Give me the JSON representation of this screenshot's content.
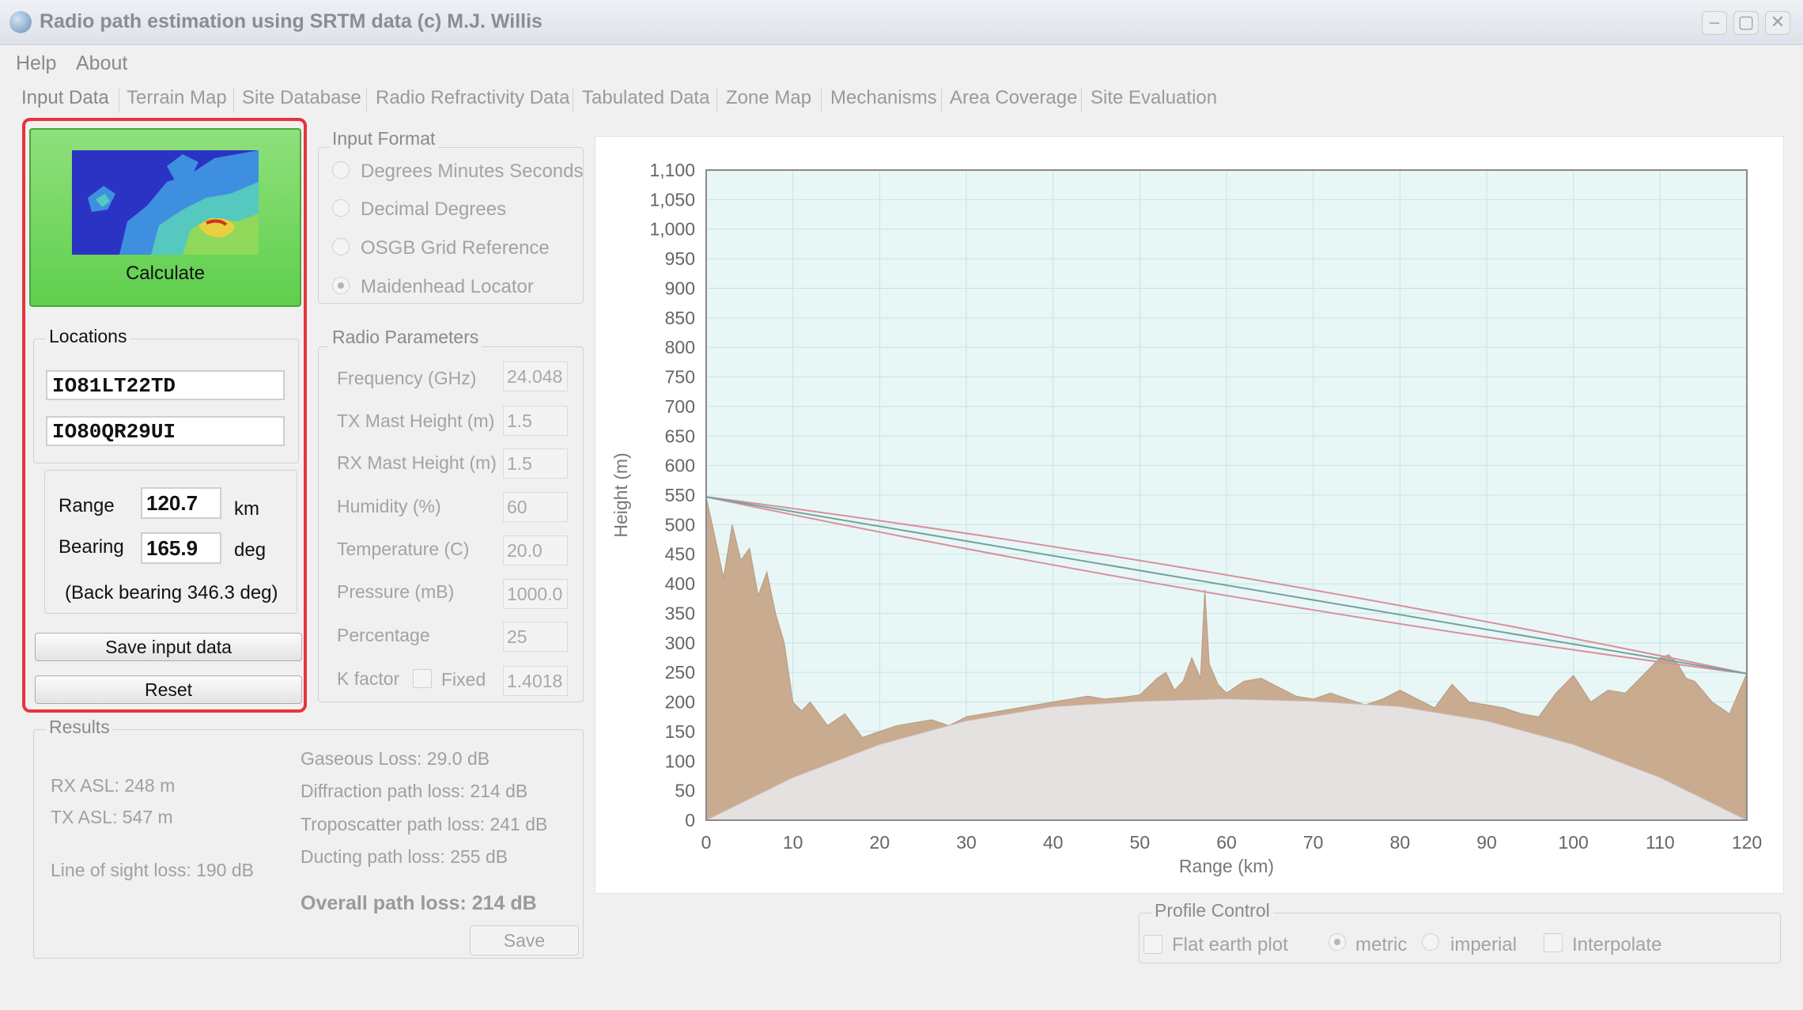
{
  "window": {
    "title": "Radio path estimation using SRTM data (c) M.J. Willis"
  },
  "menu": [
    "Help",
    "About"
  ],
  "tabs": [
    "Input Data",
    "Terrain Map",
    "Site Database",
    "Radio Refractivity Data",
    "Tabulated Data",
    "Zone Map",
    "Mechanisms",
    "Area Coverage",
    "Site Evaluation"
  ],
  "calculate": {
    "label": "Calculate"
  },
  "locations": {
    "title": "Locations",
    "tx": "IO81LT22TD",
    "rx": "IO80QR29UI",
    "range_label": "Range",
    "range": "120.7",
    "range_unit": "km",
    "bearing_label": "Bearing",
    "bearing": "165.9",
    "bearing_unit": "deg",
    "back_bearing": "(Back bearing 346.3 deg)"
  },
  "buttons": {
    "save_input": "Save input data",
    "reset": "Reset",
    "save": "Save"
  },
  "input_format": {
    "title": "Input Format",
    "options": [
      "Degrees Minutes Seconds",
      "Decimal Degrees",
      "OSGB Grid Reference",
      "Maidenhead Locator"
    ],
    "selected": "Maidenhead Locator"
  },
  "radio_params": {
    "title": "Radio Parameters",
    "frequency_label": "Frequency (GHz)",
    "frequency": "24.048",
    "tx_mast_label": "TX Mast Height (m)",
    "tx_mast": "1.5",
    "rx_mast_label": "RX Mast Height (m)",
    "rx_mast": "1.5",
    "humidity_label": "Humidity (%)",
    "humidity": "60",
    "temperature_label": "Temperature (C)",
    "temperature": "20.0",
    "pressure_label": "Pressure (mB)",
    "pressure": "1000.0",
    "percentage_label": "Percentage",
    "percentage": "25",
    "kfactor_label": "K factor",
    "fixed_label": "Fixed",
    "kfactor": "1.4018"
  },
  "results": {
    "title": "Results",
    "rx_asl": "RX ASL: 248 m",
    "tx_asl": "TX ASL: 547 m",
    "los_loss": "Line of sight loss: 190 dB",
    "gaseous": "Gaseous Loss: 29.0 dB",
    "diffraction": "Diffraction path loss: 214 dB",
    "troposcatter": "Troposcatter path loss: 241 dB",
    "ducting": "Ducting path loss: 255 dB",
    "overall": "Overall path loss: 214 dB"
  },
  "profile_control": {
    "title": "Profile Control",
    "flat_earth": "Flat earth plot",
    "metric": "metric",
    "imperial": "imperial",
    "interpolate": "Interpolate",
    "selected_unit": "metric"
  },
  "chart_data": {
    "type": "area",
    "xlabel": "Range (km)",
    "ylabel": "Height (m)",
    "xlim": [
      0,
      120
    ],
    "ylim": [
      0,
      1100
    ],
    "xticks": [
      0,
      10,
      20,
      30,
      40,
      50,
      60,
      70,
      80,
      90,
      100,
      110,
      120
    ],
    "yticks": [
      0,
      50,
      100,
      150,
      200,
      250,
      300,
      350,
      400,
      450,
      500,
      550,
      600,
      650,
      700,
      750,
      800,
      850,
      900,
      950,
      1000,
      1050,
      1100
    ],
    "grid": true,
    "colors": {
      "terrain": "#c9ab90",
      "earth": "#e6e1e1",
      "background": "#e8f6f6",
      "los": "#6fa39c",
      "fresnel": "#d9909a"
    },
    "earth_bulge": {
      "x": [
        0,
        10,
        20,
        30,
        40,
        50,
        60,
        70,
        80,
        90,
        100,
        110,
        120
      ],
      "y": [
        0,
        72,
        128,
        168,
        192,
        201,
        205,
        201,
        192,
        168,
        128,
        72,
        0
      ]
    },
    "terrain": {
      "x": [
        0,
        1,
        2,
        3,
        4,
        5,
        6,
        7,
        8,
        9,
        10,
        11,
        12,
        14,
        16,
        18,
        20,
        22,
        24,
        26,
        28,
        30,
        32,
        34,
        36,
        38,
        40,
        42,
        44,
        46,
        48,
        50,
        52,
        53,
        54,
        55,
        56,
        57,
        57.5,
        58,
        59,
        60,
        62,
        64,
        66,
        68,
        70,
        72,
        74,
        76,
        78,
        80,
        82,
        84,
        86,
        88,
        90,
        92,
        94,
        96,
        98,
        100,
        102,
        104,
        106,
        108,
        110,
        111,
        112,
        113,
        114,
        116,
        118,
        120
      ],
      "y": [
        547,
        480,
        410,
        500,
        440,
        460,
        380,
        420,
        350,
        300,
        200,
        185,
        200,
        160,
        180,
        140,
        150,
        160,
        165,
        170,
        160,
        175,
        180,
        185,
        190,
        195,
        200,
        205,
        210,
        205,
        208,
        212,
        240,
        250,
        220,
        235,
        275,
        240,
        390,
        265,
        230,
        215,
        235,
        240,
        225,
        210,
        205,
        215,
        205,
        195,
        205,
        220,
        205,
        190,
        230,
        200,
        195,
        190,
        180,
        175,
        215,
        245,
        200,
        220,
        215,
        245,
        275,
        280,
        265,
        240,
        235,
        200,
        180,
        248
      ]
    },
    "series": [
      {
        "name": "",
        "x": [
          0,
          120
        ],
        "y": [
          547,
          248
        ]
      }
    ]
  }
}
